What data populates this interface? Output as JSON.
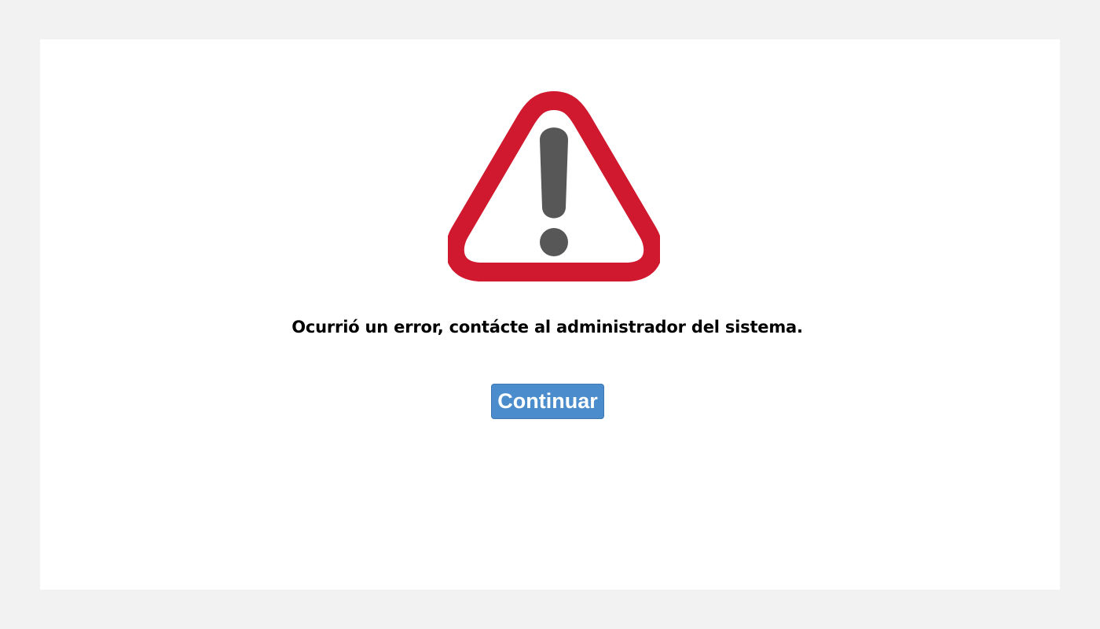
{
  "icon": {
    "name": "warning-triangle-icon",
    "border_color": "#d0192e",
    "mark_color": "#575757"
  },
  "error": {
    "message": "Ocurrió un error, contácte al administrador del sistema."
  },
  "actions": {
    "continue_label": "Continuar",
    "button_color": "#4b8ccc"
  },
  "colors": {
    "background": "#f2f2f2",
    "panel": "#ffffff"
  }
}
